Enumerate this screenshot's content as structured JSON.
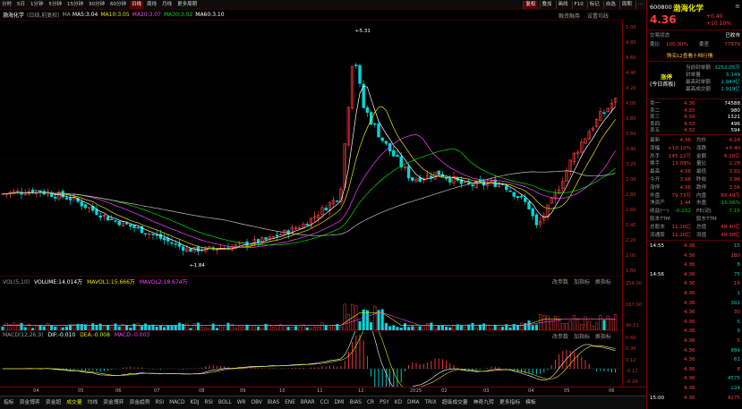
{
  "toolbar": {
    "periods": [
      "分时",
      "5日",
      "1分钟",
      "5分钟",
      "15分钟",
      "30分钟",
      "60分钟",
      "日线",
      "周线",
      "月线",
      "更多周期"
    ],
    "active_period": "日线",
    "right_buttons": [
      "复权",
      "叠加",
      "画线",
      "F10",
      "标记",
      "自选",
      "周期",
      "···"
    ],
    "right_active": "复权"
  },
  "main": {
    "stock_name": "渤海化学",
    "fq_label": "(日线,前复权)",
    "ma_label": "MA",
    "ma5": "MA5:3.04",
    "ma10": "MA10:3.05",
    "ma20": "MA20:3.07",
    "ma30": "MA30:3.02",
    "ma60": "MA60:3.10",
    "links": [
      "融资融券",
      "设置均线"
    ],
    "high_note": "←5.31",
    "low_note": "←1.84",
    "yaxis": [
      "5.00",
      "4.80",
      "4.60",
      "4.40",
      "4.20",
      "4.00",
      "3.80",
      "3.60",
      "3.40",
      "3.20",
      "3.00",
      "2.80",
      "2.60",
      "2.40",
      "2.20",
      "2.00",
      "1.80"
    ]
  },
  "volume": {
    "name": "VOL(5,10)",
    "vol": "VOLUME:14.014万",
    "mavol1": "MAVOL1:15.666万",
    "mavol2": "MAVOL2:18.674万",
    "links": [
      "改参数",
      "加指标",
      "换指标"
    ],
    "yaxis": [
      "254.00",
      "167.00",
      "90.01"
    ]
  },
  "macd": {
    "name": "MACD(12,26,9)",
    "dif": "DIF:-0.010",
    "dea": "DEA:-0.008",
    "macd": "MACD:-0.003",
    "links": [
      "改参数",
      "加指标",
      "换指标"
    ],
    "yaxis": [
      "0.60",
      "0.36",
      "0.12",
      "-0.12",
      "-0.24"
    ]
  },
  "date_axis": [
    "04",
    "05",
    "06",
    "07",
    "08",
    "09",
    "10",
    "11",
    "12",
    "2025",
    "02",
    "03",
    "04",
    "05",
    "06"
  ],
  "bottom_tabs": [
    "指标",
    "资金博弈",
    "资金超",
    "成交量",
    "均线",
    "资金博弈",
    "资金趋势",
    "RSI",
    "MACD",
    "KDJ",
    "RSI",
    "BOLL",
    "WR",
    "OBV",
    "BIAS",
    "ENE",
    "BRAR",
    "CCI",
    "DMI",
    "BIAS",
    "CR",
    "PSY",
    "KD",
    "DMA",
    "TRIX",
    "超级成交量",
    "神奇九转",
    "更多指标",
    "模板"
  ],
  "bottom_active": "成交量",
  "quote": {
    "code": "600800",
    "name": "渤海化学",
    "price": "4.36",
    "change": "+0.40",
    "change_pct": "+10.10%",
    "trade_status": "交易状态",
    "trade_status_val": "已收市",
    "weibi_label": "委比",
    "weibi": "100.00%",
    "weicha_label": "委差",
    "weicha": "77979",
    "level2_link": "购买L2查看十档行情",
    "limit_box": {
      "tag1": "涨停",
      "tag2": "(今日首板)",
      "rows": [
        {
          "k": "当前封单额",
          "v": "3252.05万"
        },
        {
          "k": "封单量",
          "v": "5.149"
        },
        {
          "k": "最高封单额",
          "v": "2.944亿"
        },
        {
          "k": "最高成交额",
          "v": "1.919亿"
        }
      ]
    },
    "book": [
      {
        "l": "卖一",
        "p": "4.36",
        "v": "74588"
      },
      {
        "l": "卖二",
        "p": "4.35",
        "v": "980"
      },
      {
        "l": "卖三",
        "p": "4.34",
        "v": "1321"
      },
      {
        "l": "卖四",
        "p": "4.33",
        "v": "496"
      },
      {
        "l": "卖五",
        "p": "4.32",
        "v": "594"
      }
    ],
    "stats": [
      {
        "a": "最新",
        "av": "4.36",
        "b": "均价",
        "bv": "4.24"
      },
      {
        "a": "涨幅",
        "av": "+10.10%",
        "b": "涨跌",
        "bv": "+0.40"
      },
      {
        "a": "总手",
        "av": "145.22万",
        "b": "金额",
        "bv": "6.16亿"
      },
      {
        "a": "换手",
        "av": "13.09%",
        "b": "量比",
        "bv": "2.29"
      },
      {
        "a": "最高",
        "av": "4.36",
        "b": "最低",
        "bv": "3.91"
      },
      {
        "a": "今开",
        "av": "3.98",
        "b": "昨收",
        "bv": "3.96"
      },
      {
        "a": "涨停",
        "av": "4.36",
        "b": "跌停",
        "bv": "3.56"
      },
      {
        "a": "外盘",
        "av": "79.73万",
        "b": "内盘",
        "bv": "65.49万"
      },
      {
        "a": "净资产",
        "av": "1.44",
        "b": "市盈",
        "bv": "-10.06%"
      },
      {
        "a": "收益(一)",
        "av": "-0.152",
        "b": "PE(动)",
        "bv": "-7.16"
      },
      {
        "a": "股本TTM",
        "av": "",
        "b": "股东TTM",
        "bv": ""
      },
      {
        "a": "总股本",
        "av": "11.10亿",
        "b": "总值",
        "bv": "48.40亿"
      },
      {
        "a": "流通股",
        "av": "11.10亿",
        "b": "流值",
        "bv": "48.38亿"
      }
    ],
    "ticks": [
      {
        "t": "14:55",
        "p": "4.36",
        "v": "15"
      },
      {
        "t": "",
        "p": "4.36",
        "v": "180"
      },
      {
        "t": "",
        "p": "4.36",
        "v": "8"
      },
      {
        "t": "14:56",
        "p": "4.36",
        "v": "75"
      },
      {
        "t": "",
        "p": "4.36",
        "v": "16"
      },
      {
        "t": "",
        "p": "4.36",
        "v": "1"
      },
      {
        "t": "",
        "p": "4.36",
        "v": "301"
      },
      {
        "t": "",
        "p": "4.36",
        "v": "30"
      },
      {
        "t": "",
        "p": "4.36",
        "v": "5"
      },
      {
        "t": "",
        "p": "4.36",
        "v": "9"
      },
      {
        "t": "",
        "p": "4.36",
        "v": "5"
      },
      {
        "t": "",
        "p": "4.36",
        "v": "884"
      },
      {
        "t": "",
        "p": "4.36",
        "v": "61"
      },
      {
        "t": "",
        "p": "4.36",
        "v": "8"
      },
      {
        "t": "",
        "p": "4.36",
        "v": "4575"
      },
      {
        "t": "",
        "p": "4.36",
        "v": "224"
      },
      {
        "t": "15:00",
        "p": "4.36",
        "v": "4275"
      }
    ],
    "colors": {
      "up": "#ff3c3c",
      "down": "#00c8c8",
      "accent": "#e8e800"
    }
  }
}
